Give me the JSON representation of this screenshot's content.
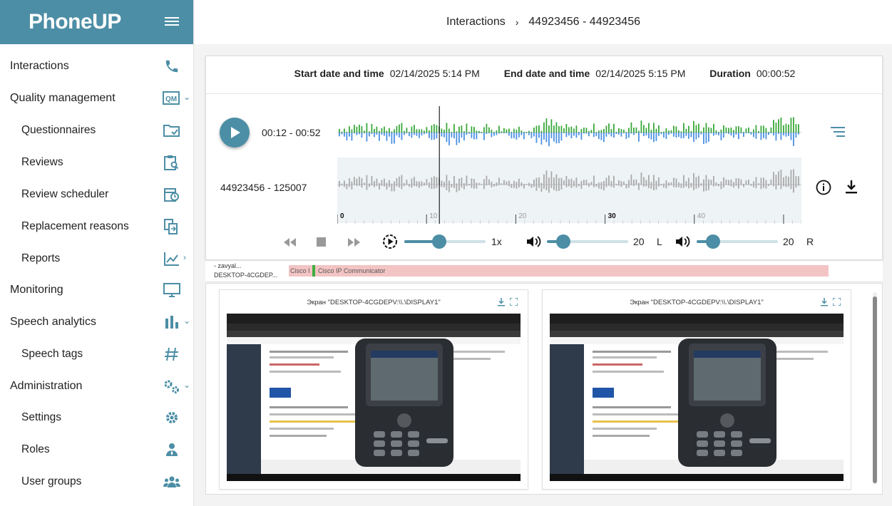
{
  "app": {
    "logo": "PhoneUP"
  },
  "sidebar": {
    "items": [
      {
        "label": "Interactions",
        "icon": "phone-icon"
      },
      {
        "label": "Quality management",
        "icon": "qm-icon",
        "badge": "QM"
      },
      {
        "label": "Questionnaires",
        "icon": "folder-check-icon"
      },
      {
        "label": "Reviews",
        "icon": "clipboard-search-icon"
      },
      {
        "label": "Review scheduler",
        "icon": "calendar-clock-icon"
      },
      {
        "label": "Replacement reasons",
        "icon": "file-replace-icon"
      },
      {
        "label": "Reports",
        "icon": "chart-line-icon"
      },
      {
        "label": "Monitoring",
        "icon": "monitor-icon"
      },
      {
        "label": "Speech analytics",
        "icon": "bar-chart-icon"
      },
      {
        "label": "Speech tags",
        "icon": "hashtag-icon"
      },
      {
        "label": "Administration",
        "icon": "gears-icon"
      },
      {
        "label": "Settings",
        "icon": "gear-icon"
      },
      {
        "label": "Roles",
        "icon": "user-tie-icon"
      },
      {
        "label": "User groups",
        "icon": "users-icon"
      }
    ]
  },
  "header": {
    "crumb_root": "Interactions",
    "separator": "›",
    "crumb_current": "44923456 - 44923456"
  },
  "interaction": {
    "start_label": "Start date and time",
    "start_value": "02/14/2025 5:14 PM",
    "end_label": "End date and time",
    "end_value": "02/14/2025 5:15 PM",
    "duration_label": "Duration",
    "duration_value": "00:00:52"
  },
  "player": {
    "time_range": "00:12 - 00:52",
    "participant": "44923456  -  125007",
    "cursor_seconds": 12,
    "total_seconds": 52,
    "timeline_labels": [
      "0",
      "10",
      "20",
      "30",
      "40"
    ],
    "timeline_bold": [
      "0",
      "30"
    ],
    "speed_label": "1x",
    "speed_fraction": 0.43,
    "volume_left": "20",
    "volume_left_fraction": 0.2,
    "channel_left": "L",
    "volume_right": "20",
    "volume_right_fraction": 0.2,
    "channel_right": "R"
  },
  "events": {
    "user_line1": "- zavyal...",
    "user_line2": "DESKTOP-4CGDEP...",
    "event1": "Cisco I",
    "event2": "Cisco IP Communicator"
  },
  "screens": [
    {
      "title": "Экран \"DESKTOP-4CGDEPV:\\\\.\\DISPLAY1\""
    },
    {
      "title": "Экран \"DESKTOP-4CGDEPV:\\\\.\\DISPLAY1\""
    }
  ],
  "colors": {
    "accent": "#4c8ea5",
    "wave_positive": "#3aa83a",
    "wave_negative": "#4a90e2",
    "wave_grey": "#aaaaaa",
    "event_bar": "#f3c4c4"
  }
}
